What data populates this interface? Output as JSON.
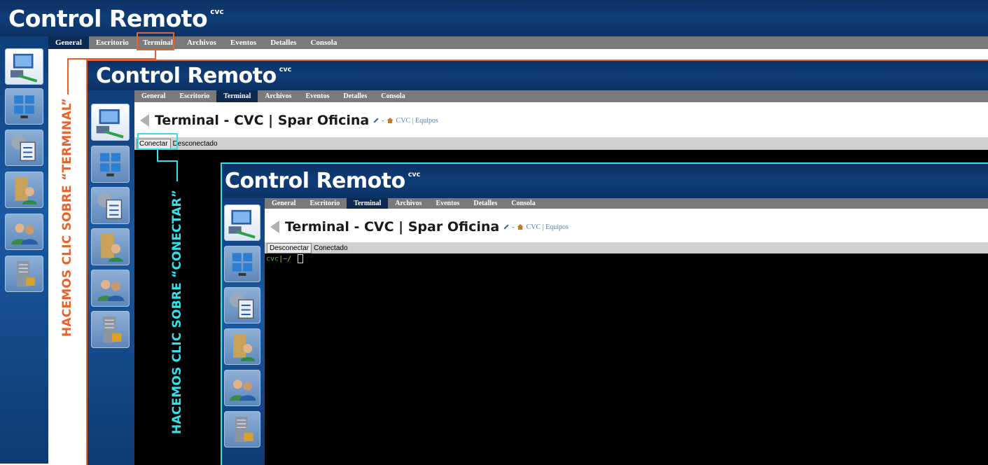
{
  "app": {
    "title": "Control Remoto",
    "title_sup": "cvc"
  },
  "nav": {
    "tabs": [
      "General",
      "Escritorio",
      "Terminal",
      "Archivos",
      "Eventos",
      "Detalles",
      "Consola"
    ]
  },
  "page": {
    "title": "Terminal - CVC | Spar Oficina",
    "breadcrumb": "CVC | Equipos"
  },
  "state_disconnected": {
    "button": "Conectar",
    "status": "Desconectado"
  },
  "state_connected": {
    "button": "Desconectar",
    "status": "Conectado",
    "prompt_user": "cvc",
    "prompt_path": "|~/"
  },
  "annotations": {
    "click_terminal": "HACEMOS CLIC SOBRE “TERMINAL”",
    "click_conectar": "HACEMOS CLIC SOBRE “CONECTAR”"
  },
  "colors": {
    "orange": "#e8622c",
    "cyan": "#2ee3ee",
    "header": "#0f3d78",
    "navbar": "#7a7a7a",
    "terminal": "#000000",
    "prompt_green": "#3bbf3b"
  },
  "icons": [
    "computer-network-icon",
    "desktop-windows-icon",
    "settings-list-icon",
    "folder-user-icon",
    "users-icon",
    "server-lock-icon"
  ]
}
